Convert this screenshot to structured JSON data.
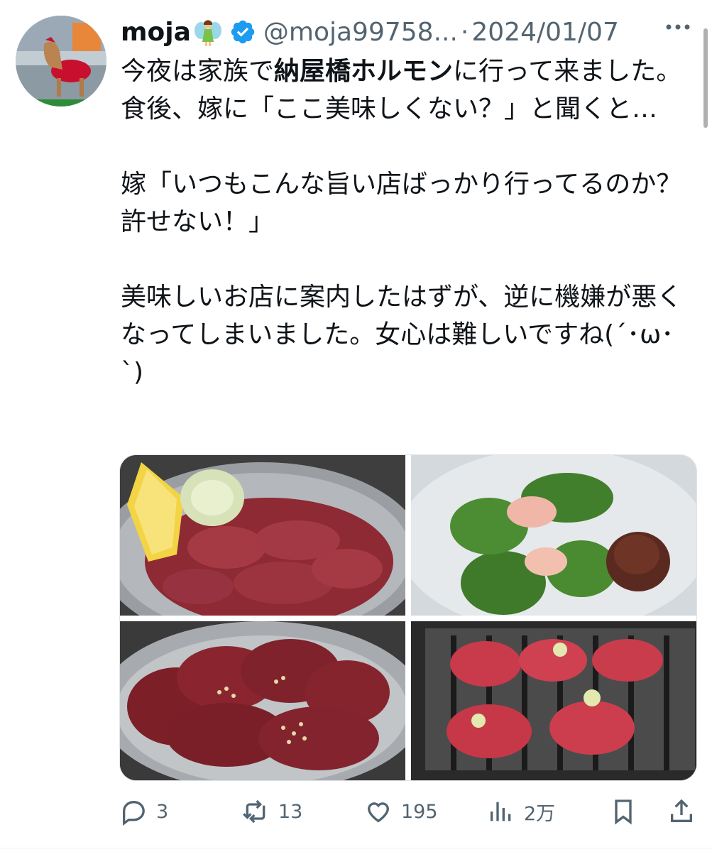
{
  "user": {
    "display_name": "moja",
    "handle": "@moja99758...",
    "separator": "·",
    "date": "2024/01/07"
  },
  "tweet": {
    "line1_pre": "今夜は家族で",
    "line1_bold": "納屋橋ホルモン",
    "line1_post": "に行って来ました。食後、嫁に「ここ美味しくない？」と聞くと…",
    "para2": "嫁「いつもこんな旨い店ばっかり行ってるのか？許せない！」",
    "para3": "美味しいお店に案内したはずが、逆に機嫌が悪くなってしまいました。女心は難しいですね(´･ω･`)"
  },
  "media": {
    "photos": [
      {
        "name": "beef-tongue-plate"
      },
      {
        "name": "shiso-wrapped-sashimi"
      },
      {
        "name": "marbled-beef-plate"
      },
      {
        "name": "meat-on-grill"
      }
    ]
  },
  "actions": {
    "reply_count": "3",
    "retweet_count": "13",
    "like_count": "195",
    "views_count": "2万"
  },
  "colors": {
    "text": "#0f1419",
    "secondary": "#536471",
    "verified": "#1d9bf0"
  }
}
